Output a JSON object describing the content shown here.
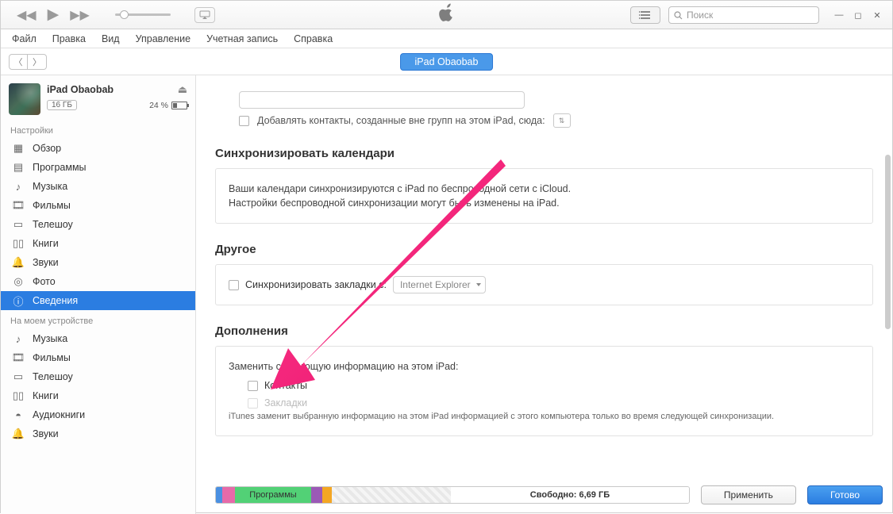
{
  "titlebar": {
    "search_placeholder": "Поиск"
  },
  "menubar": [
    "Файл",
    "Правка",
    "Вид",
    "Управление",
    "Учетная запись",
    "Справка"
  ],
  "device_pill": "iPad Obaobab",
  "device": {
    "name": "iPad Obaobab",
    "capacity": "16 ГБ",
    "battery": "24 %"
  },
  "sidebar": {
    "settings_header": "Настройки",
    "settings_items": [
      {
        "icon": "grid",
        "label": "Обзор"
      },
      {
        "icon": "apps",
        "label": "Программы"
      },
      {
        "icon": "music",
        "label": "Музыка"
      },
      {
        "icon": "film",
        "label": "Фильмы"
      },
      {
        "icon": "tv",
        "label": "Телешоу"
      },
      {
        "icon": "book",
        "label": "Книги"
      },
      {
        "icon": "bell",
        "label": "Звуки"
      },
      {
        "icon": "camera",
        "label": "Фото"
      },
      {
        "icon": "info",
        "label": "Сведения",
        "selected": true
      }
    ],
    "ondevice_header": "На моем устройстве",
    "ondevice_items": [
      {
        "icon": "music",
        "label": "Музыка"
      },
      {
        "icon": "film",
        "label": "Фильмы"
      },
      {
        "icon": "tv",
        "label": "Телешоу"
      },
      {
        "icon": "book",
        "label": "Книги"
      },
      {
        "icon": "audiobook",
        "label": "Аудиокниги"
      },
      {
        "icon": "bell",
        "label": "Звуки"
      }
    ]
  },
  "content": {
    "add_contacts_label": "Добавлять контакты, созданные вне групп на этом iPad, сюда:",
    "calendars": {
      "heading": "Синхронизировать календари",
      "line1": "Ваши календари синхронизируются с iPad по беспроводной сети с iCloud.",
      "line2": "Настройки беспроводной синхронизации могут быть изменены на iPad."
    },
    "other": {
      "heading": "Другое",
      "sync_bookmarks_label": "Синхронизировать закладки с:",
      "browser": "Internet Explorer"
    },
    "addons": {
      "heading": "Дополнения",
      "replace_label": "Заменить следующую информацию на этом iPad:",
      "contacts_label": "Контакты",
      "bookmarks_label": "Закладки",
      "footnote": "iTunes заменит выбранную информацию на этом iPad информацией с этого компьютера только во время следующей синхронизации."
    }
  },
  "footer": {
    "apps_label": "Программы",
    "free_label": "Свободно: 6,69 ГБ",
    "apply": "Применить",
    "done": "Готово"
  }
}
